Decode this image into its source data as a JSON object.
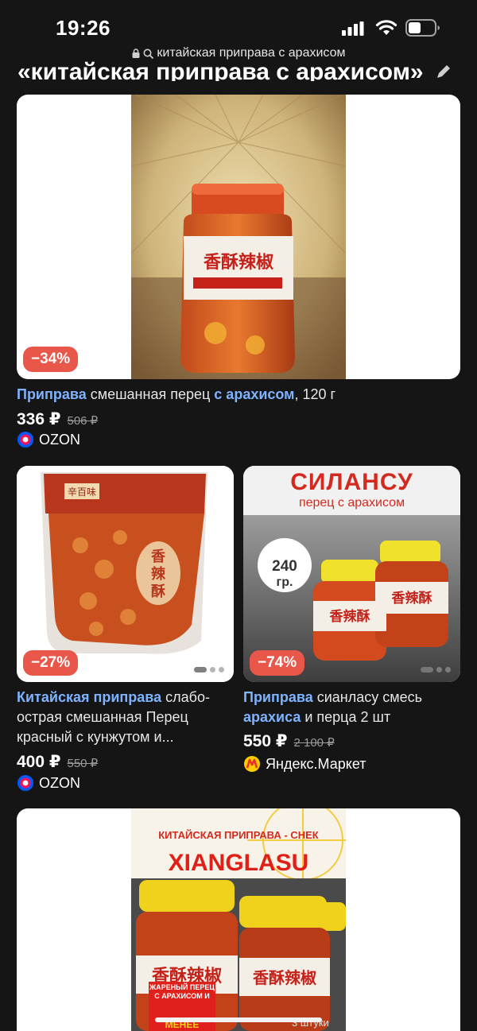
{
  "status_bar": {
    "time": "19:26"
  },
  "browser": {
    "url": "китайская приправа с арахисом"
  },
  "page": {
    "heading": "«китайская приправа с арахисом»"
  },
  "colors": {
    "background": "#151515",
    "discount": "#e8574a",
    "highlight": "#7eb3ff",
    "ozon": "#005bff",
    "yandex_market": "#ffcc00"
  },
  "products": [
    {
      "discount": "−34%",
      "title_highlight_1": "Приправа",
      "title_text_1": " смешанная перец ",
      "title_highlight_2": "с арахисом",
      "title_text_2": ", 120 г",
      "price": "336 ₽",
      "old_price": "506 ₽",
      "shop": "OZON",
      "shop_icon": "ozon-logo-icon"
    },
    {
      "discount": "−27%",
      "title_highlight_1": "Китайская приправа",
      "title_line_1": " слабо-",
      "title_line_2": "острая смешанная Перец",
      "title_line_3": "красный с кунжутом и...",
      "price": "400 ₽",
      "old_price": "550 ₽",
      "shop": "OZON",
      "shop_icon": "ozon-logo-icon"
    },
    {
      "discount": "−74%",
      "title_highlight_1": "Приправа",
      "title_line_1": " сианласу смесь",
      "title_highlight_2": "арахиса",
      "title_line_2": " и перца 2 шт",
      "price": "550 ₽",
      "old_price": "2 100 ₽",
      "shop": "Яндекс.Маркет",
      "shop_icon": "yandex-market-logo-icon",
      "image_text": {
        "brand": "СИЛАНСУ",
        "subtitle": "перец с арахисом",
        "weight_value": "240",
        "weight_unit": "гр."
      }
    },
    {
      "image_text": {
        "top": "КИТАЙСКАЯ ПРИПРАВА - СНЕК",
        "brand": "XIANGLASU",
        "label": "ЖАРЕНЫЙ ПЕРЕЦ С АРАХИСОМ И",
        "extra": "МЕНЕЕ",
        "count": "3 штуки"
      }
    }
  ]
}
